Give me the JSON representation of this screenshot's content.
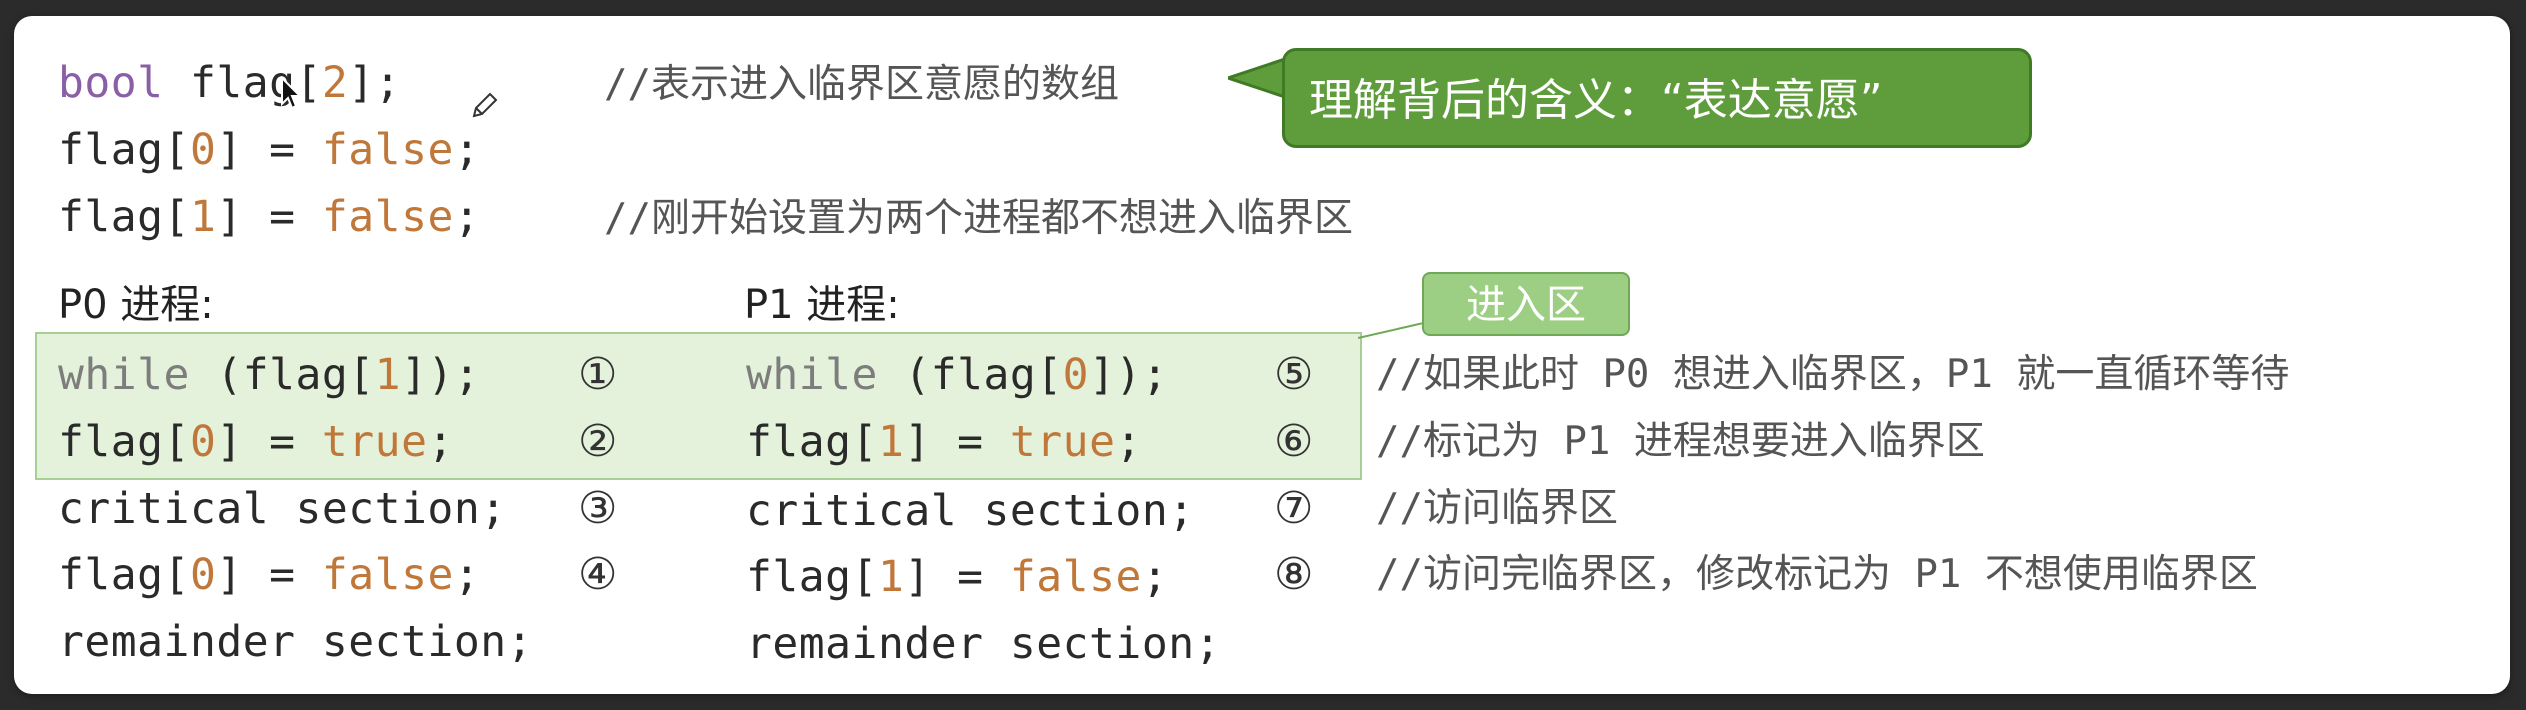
{
  "decl": {
    "l1_kw": "bool",
    "l1_a": " flag[",
    "l1_num": "2",
    "l1_b": "];",
    "l2_a": "flag[",
    "l2_num": "0",
    "l2_b": "] = ",
    "l2_val": "false",
    "l2_c": ";",
    "l3_a": "flag[",
    "l3_num": "1",
    "l3_b": "] = ",
    "l3_val": "false",
    "l3_c": ";"
  },
  "comments": {
    "c1": "//表示进入临界区意愿的数组",
    "c3": "//刚开始设置为两个进程都不想进入临界区",
    "c5": "//如果此时 P0 想进入临界区，P1 就一直循环等待",
    "c6": "//标记为 P1 进程想要进入临界区",
    "c7": "//访问临界区",
    "c8": "//访问完临界区，修改标记为 P1 不想使用临界区"
  },
  "callout": {
    "text": "理解背后的含义：“表达意愿”"
  },
  "tag": {
    "text": "进入区"
  },
  "p0": {
    "label": "P0 进程:",
    "while_kw": "while",
    "while_a": " (flag[",
    "while_num": "1",
    "while_b": "]);",
    "set_a": "flag[",
    "set_num": "0",
    "set_b": "] = ",
    "set_val": "true",
    "set_c": ";",
    "critical": "critical section;",
    "reset_a": "flag[",
    "reset_num": "0",
    "reset_b": "] = ",
    "reset_val": "false",
    "reset_c": ";",
    "remainder": "remainder section;"
  },
  "p1": {
    "label": "P1 进程:",
    "while_kw": "while",
    "while_a": " (flag[",
    "while_num": "0",
    "while_b": "]);",
    "set_a": "flag[",
    "set_num": "1",
    "set_b": "] = ",
    "set_val": "true",
    "set_c": ";",
    "critical": "critical section;",
    "reset_a": "flag[",
    "reset_num": "1",
    "reset_b": "] = ",
    "reset_val": "false",
    "reset_c": ";",
    "remainder": "remainder section;"
  },
  "steps": [
    "①",
    "②",
    "③",
    "④",
    "⑤",
    "⑥",
    "⑦",
    "⑧"
  ],
  "colors": {
    "callout_bg": "#5f9d3c",
    "tag_bg": "#9ccf83",
    "highlight_bg": "#cde6be",
    "keyword": "#8a5fa6",
    "literal": "#c0783a"
  },
  "icons": {
    "cursor": "mouse-cursor-icon",
    "pencil": "pencil-icon"
  }
}
